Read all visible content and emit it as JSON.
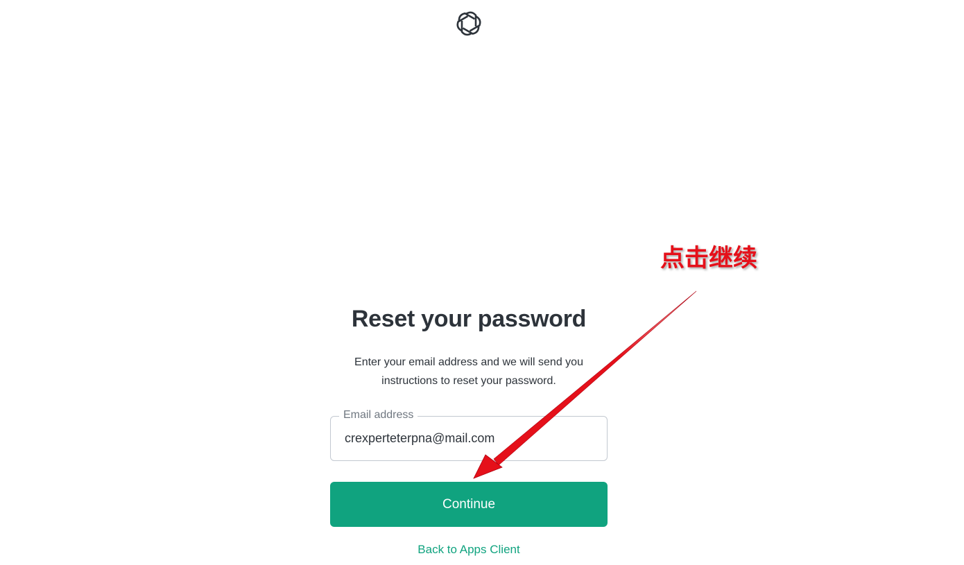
{
  "logo": {
    "icon": "openai-logo-icon"
  },
  "heading": "Reset your password",
  "description": "Enter your email address and we will send you instructions to reset your password.",
  "email_field": {
    "label": "Email address",
    "value": "crexperteterpna@mail.com"
  },
  "continue_label": "Continue",
  "back_link_label": "Back to Apps Client",
  "annotation": {
    "text": "点击继续",
    "color": "#e5101a"
  },
  "colors": {
    "accent": "#10a37f",
    "text": "#2d333a",
    "border": "#c2c8d0"
  }
}
